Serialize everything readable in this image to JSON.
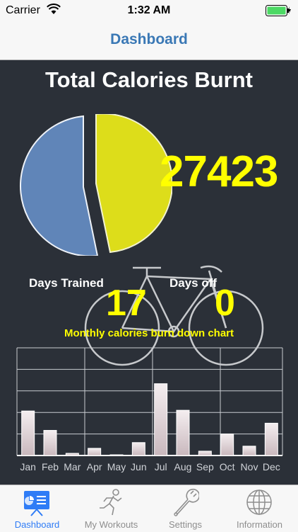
{
  "status": {
    "carrier": "Carrier",
    "time": "1:32 AM"
  },
  "nav": {
    "title": "Dashboard"
  },
  "dashboard": {
    "title": "Total Calories Burnt",
    "total_calories": "27423",
    "days_trained_label": "Days Trained",
    "days_trained": "17",
    "days_off_label": "Days off",
    "days_off": "0",
    "chart_title": "Monthly calories burn down chart"
  },
  "chart_data": {
    "type": "bar",
    "categories": [
      "Jan",
      "Feb",
      "Mar",
      "Apr",
      "May",
      "Jun",
      "Jul",
      "Aug",
      "Sep",
      "Oct",
      "Nov",
      "Dec"
    ],
    "values": [
      3100,
      1750,
      150,
      500,
      50,
      900,
      5000,
      3150,
      300,
      1500,
      650,
      2250
    ],
    "ylim": [
      0,
      7500
    ],
    "grid": true
  },
  "tabs": [
    {
      "label": "Dashboard",
      "icon": "presentation-board-icon",
      "active": true
    },
    {
      "label": "My Workouts",
      "icon": "runner-icon",
      "active": false
    },
    {
      "label": "Settings",
      "icon": "wrench-icon",
      "active": false
    },
    {
      "label": "Information",
      "icon": "globe-icon",
      "active": false
    }
  ],
  "colors": {
    "pie_trained": "#dddd1a",
    "pie_off": "#6085b8",
    "accent": "#ffff00",
    "tab_active": "#2f7cf6",
    "nav_title": "#3a78b5"
  }
}
